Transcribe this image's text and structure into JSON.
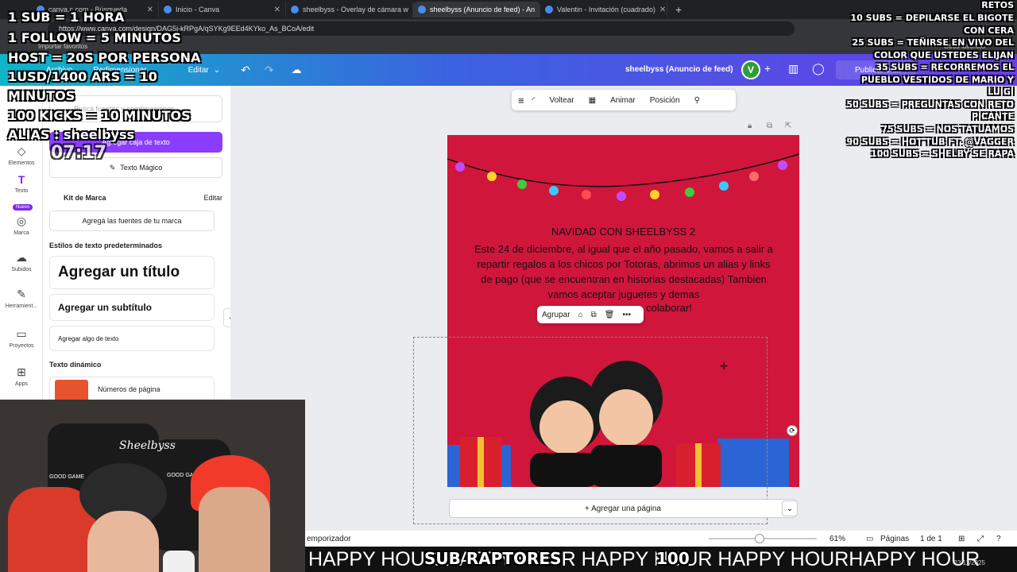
{
  "browser": {
    "tabs": [
      {
        "label": "canva.c.com - Búsqueda",
        "active": false
      },
      {
        "label": "Inicio - Canva",
        "active": false
      },
      {
        "label": "sheelbyss - Overlay de cámara w",
        "active": false
      },
      {
        "label": "sheelbyss (Anuncio de feed) - An",
        "active": true
      },
      {
        "label": "Valentin - Invitación (cuadrado)",
        "active": false
      }
    ],
    "new_tab": "+",
    "url": "https://www.canva.com/design/DAG5j-kRPgA/qSYKg9EEd4KYko_As_BCoA/edit",
    "bookmarks": [
      "Importar favoritos",
      "Otros favoritos"
    ]
  },
  "header": {
    "archivo": "Archivo",
    "redimensionar": "Redimensionar",
    "editar": "Editar",
    "doc_name": "sheelbyss (Anuncio de feed)",
    "avatar_letter": "V",
    "publish_label": "Publicar en..."
  },
  "rail": {
    "items": [
      "Elementos",
      "Texto",
      "Marca",
      "Subidos",
      "Herramient...",
      "Proyectos",
      "Apps"
    ],
    "new_badge": "Nuevo"
  },
  "panel": {
    "search_placeholder": "Buscá fuentes y combinaciones",
    "add_textbox": "Agregar caja de texto",
    "magic_text": "Texto Mágico",
    "brand_kit": "Kit de Marca",
    "brand_edit": "Editar",
    "brand_fonts": "Agregá las fuentes de tu marca",
    "default_styles": "Estilos de texto predeterminados",
    "add_title": "Agregar un título",
    "add_subtitle": "Agregar un subtítulo",
    "add_body": "Agregar algo de texto",
    "dynamic_text": "Texto dinámico",
    "page_numbers": "Números de página"
  },
  "toolbar": {
    "flip": "Voltear",
    "animate": "Animar",
    "position": "Posición"
  },
  "design": {
    "title": "NAVIDAD CON SHEELBYSS 2",
    "body": "Este 24 de diciembre, al igual que el año pasado, vamos a salir a repartir regalos a los chicos por Totoras, abrimos un alias y links de pago (que se encuentran en historias destacadas) Tambien vamos aceptar juguetes y demas",
    "body_end": "colaborar!",
    "bg_color": "#d0163b"
  },
  "group_toolbar": {
    "label": "Agrupar"
  },
  "add_page": "+ Agregar una página",
  "statusbar": {
    "temporizador": "emporizador",
    "zoom": "61%",
    "pages_label": "Páginas",
    "page_count": "1 de 1"
  },
  "ticker": {
    "text": "HAPPY HOUR HAPPY HOUR HAPPY HOUR HAPPY HOURHAPPY HOUR",
    "sub_label": "SUB RAPTORES",
    "number": "100"
  },
  "overlay_left": [
    "1 SUB = 1 HORA",
    "1 FOLLOW  = 5 MINUTOS",
    "HOST = 20S POR PERSONA",
    "1USD/1400    ARS    =    10",
    "MINUTOS",
    "100 KICKS = 10 MINUTOS",
    "ALIAS : sheelbyss"
  ],
  "overlay_timer": "07:17",
  "overlay_right": [
    "RETOS",
    "10 SUBS = DEPILARSE EL BIGOTE",
    "CON CERA",
    "25 SUBS = TEÑIRSE EN VIVO DEL",
    "COLOR QUE USTEDES ELIJAN",
    "35 SUBS = RECORREMOS EL",
    "PUEBLO VESTIDOS DE MARIO Y",
    "LUIGI",
    "50 SUBS = PREGUNTAS CON RETO",
    "PICANTE",
    "75 SUBS = NOS TATUAMOS",
    "90 SUBS = HOT TUB FT. @VAGGER",
    "100 SUBS = SHELBY SE RAPA"
  ],
  "webcam": {
    "chair_logo": "Sheelbyss",
    "chair_label": "GOOD GAME"
  },
  "taskbar": {
    "date": "23/11/2025"
  }
}
